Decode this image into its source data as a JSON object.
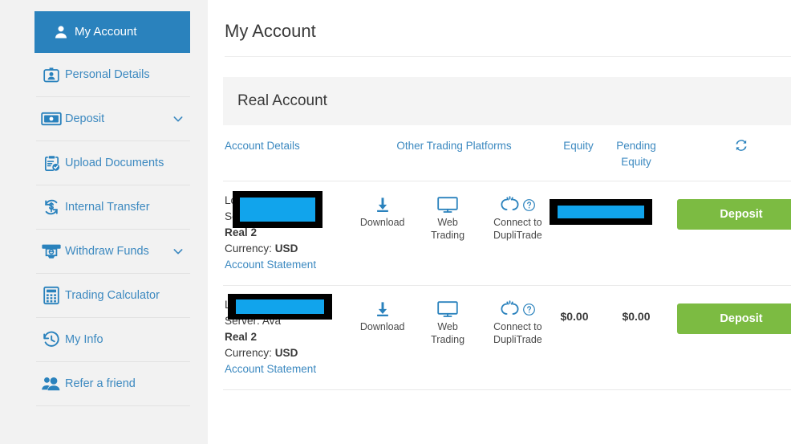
{
  "colors": {
    "accent_blue": "#2a82bd",
    "link_blue": "#3c89c0",
    "deposit_green": "#7cbb42",
    "redaction_black": "#000000",
    "redaction_blue": "#11a4ec",
    "page_bg": "#f2f2f2",
    "panel_bg": "#f4f4f4"
  },
  "sidebar": {
    "items": [
      {
        "label": "My Account",
        "icon": "user-icon",
        "active": true,
        "expandable": false
      },
      {
        "label": "Personal Details",
        "icon": "id-card-icon",
        "active": false,
        "expandable": false
      },
      {
        "label": "Deposit",
        "icon": "banknote-icon",
        "active": false,
        "expandable": true
      },
      {
        "label": "Upload Documents",
        "icon": "clipboard-check-icon",
        "active": false,
        "expandable": false
      },
      {
        "label": "Internal Transfer",
        "icon": "transfer-dollar-icon",
        "active": false,
        "expandable": false
      },
      {
        "label": "Withdraw Funds",
        "icon": "atm-cash-icon",
        "active": false,
        "expandable": true
      },
      {
        "label": "Trading Calculator",
        "icon": "calculator-icon",
        "active": false,
        "expandable": false
      },
      {
        "label": "My Info",
        "icon": "history-clock-icon",
        "active": false,
        "expandable": false
      },
      {
        "label": "Refer a friend",
        "icon": "people-icon",
        "active": false,
        "expandable": false
      }
    ]
  },
  "main": {
    "page_title": "My Account",
    "panel_title": "Real Account",
    "refresh_icon": "refresh-icon",
    "columns": {
      "details": "Account Details",
      "platforms": "Other Trading Platforms",
      "equity": "Equity",
      "pending_equity": "Pending Equity"
    },
    "platform_actions": [
      {
        "label": "Download",
        "icon": "download-icon"
      },
      {
        "label": "Web Trading",
        "icon": "monitor-icon"
      },
      {
        "label": "Connect to DupliTrade",
        "icon": "duplitrade-icon",
        "help_icon": "question-circle-icon"
      }
    ],
    "rows": [
      {
        "login_label": "Login:",
        "login_value": "",
        "login_redacted": true,
        "server_label": "Server:",
        "server_value": "",
        "server_redacted": true,
        "account_type": "Real 2",
        "currency_label": "Currency:",
        "currency_value": "USD",
        "statement_link": "Account Statement",
        "equity": "",
        "equity_redacted": true,
        "pending_equity": "",
        "deposit_label": "Deposit"
      },
      {
        "login_label": "Login:",
        "login_value": "",
        "login_redacted": true,
        "server_label": "Server:",
        "server_value": "Ava",
        "server_redacted": true,
        "account_type": "Real 2",
        "currency_label": "Currency:",
        "currency_value": "USD",
        "statement_link": "Account Statement",
        "equity": "$0.00",
        "equity_redacted": false,
        "pending_equity": "$0.00",
        "deposit_label": "Deposit"
      }
    ]
  }
}
